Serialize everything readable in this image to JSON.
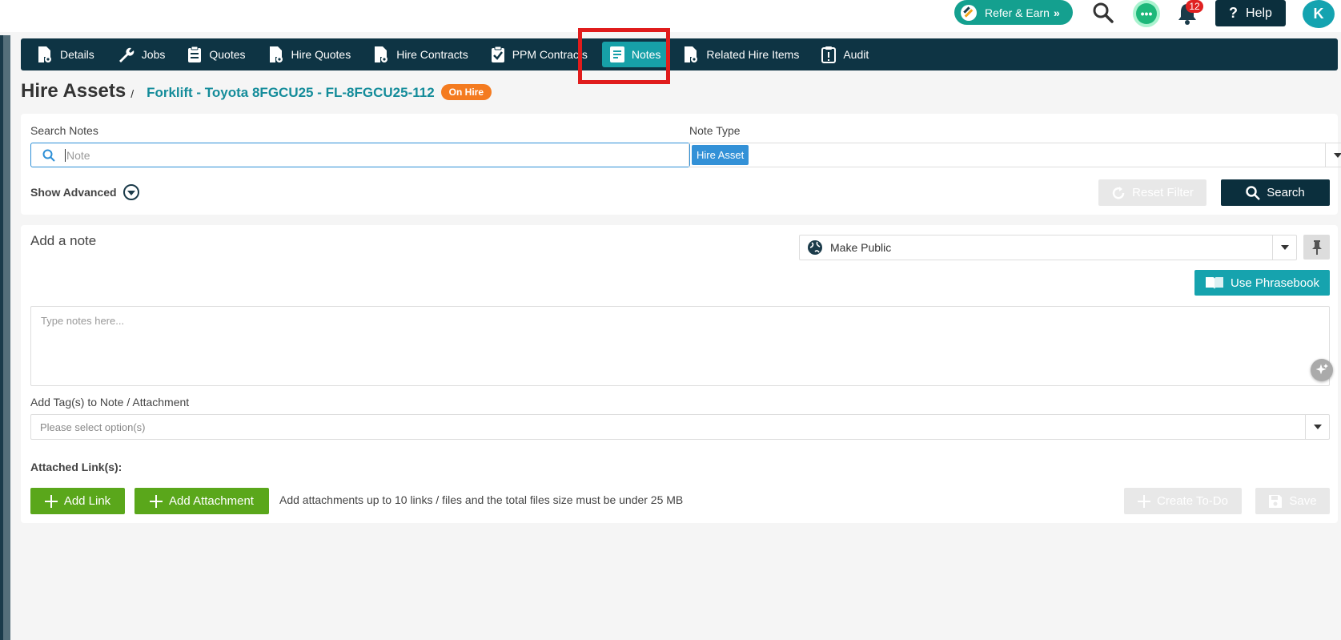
{
  "topbar": {
    "refer_label": "Refer & Earn",
    "notification_count": "12",
    "help_label": "Help",
    "avatar_initial": "K"
  },
  "nav": {
    "items": [
      {
        "label": "Details",
        "icon": "document-gear-icon"
      },
      {
        "label": "Jobs",
        "icon": "wrench-icon"
      },
      {
        "label": "Quotes",
        "icon": "clipboard-icon"
      },
      {
        "label": "Hire Quotes",
        "icon": "document-gear-icon"
      },
      {
        "label": "Hire Contracts",
        "icon": "document-gear-icon"
      },
      {
        "label": "PPM Contracts",
        "icon": "clipboard-check-icon"
      },
      {
        "label": "Notes",
        "icon": "note-icon",
        "active": true
      },
      {
        "label": "Related Hire Items",
        "icon": "document-gear-icon"
      },
      {
        "label": "Audit",
        "icon": "clipboard-alert-icon"
      }
    ]
  },
  "header": {
    "title": "Hire Assets",
    "separator": "/",
    "asset_name": "Forklift - Toyota 8FGCU25 - FL-8FGCU25-112",
    "status": "On Hire",
    "status_color": "#f47b20"
  },
  "filters": {
    "search_label": "Search Notes",
    "search_placeholder": "Note",
    "note_type_label": "Note Type",
    "note_type_selected": "Hire Asset",
    "show_advanced": "Show Advanced",
    "reset_label": "Reset Filter",
    "search_button": "Search"
  },
  "add_note": {
    "title": "Add a note",
    "visibility": "Make Public",
    "phrasebook_label": "Use Phrasebook",
    "textarea_placeholder": "Type notes here...",
    "tags_label": "Add Tag(s) to Note / Attachment",
    "tags_placeholder": "Please select option(s)",
    "attached_links_label": "Attached Link(s):",
    "add_link_label": "Add Link",
    "add_attachment_label": "Add Attachment",
    "attachment_note": "Add attachments up to 10 links / files and the total files size must be under 25 MB",
    "create_todo_label": "Create To-Do",
    "save_label": "Save"
  },
  "colors": {
    "nav_bg": "#0e3444",
    "accent_teal": "#17a0a8",
    "green": "#5aa71b",
    "dark": "#0b2f3d"
  }
}
